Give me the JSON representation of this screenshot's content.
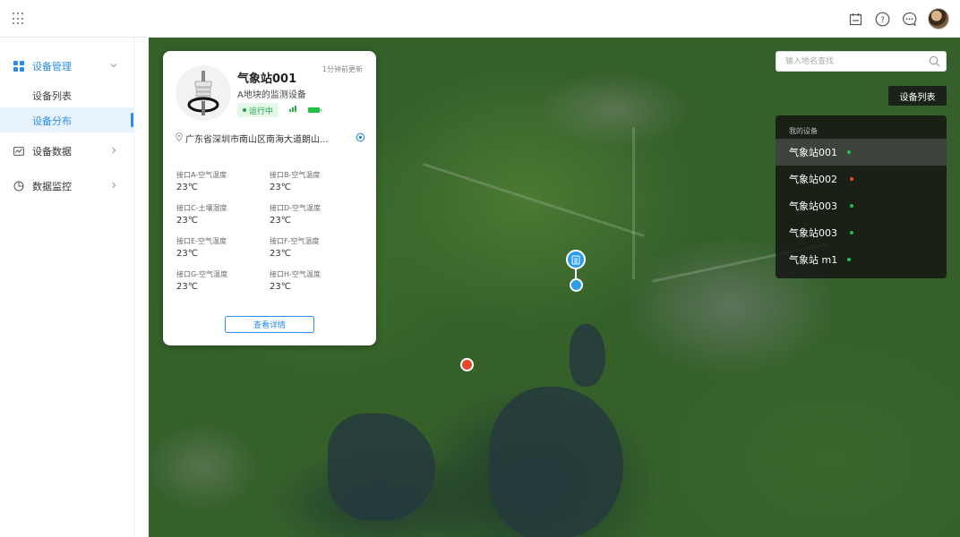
{
  "header": {
    "icons": [
      "apps-grid-icon",
      "calendar-icon",
      "help-icon",
      "message-icon",
      "user-avatar"
    ]
  },
  "sidebar": {
    "groups": [
      {
        "label": "设备管理",
        "icon": "dashboard-icon",
        "expanded": true,
        "items": [
          {
            "label": "设备列表",
            "active": false
          },
          {
            "label": "设备分布",
            "active": true
          }
        ]
      },
      {
        "label": "设备数据",
        "icon": "chart-icon",
        "expanded": false
      },
      {
        "label": "数据监控",
        "icon": "pie-icon",
        "expanded": false
      }
    ]
  },
  "map": {
    "search_placeholder": "输入地名查找",
    "device_list_button": "设备列表"
  },
  "device_card": {
    "name": "气象站001",
    "updated": "1分钟前更新",
    "subtitle": "A地块的监测设备",
    "status": "运行中",
    "address": "广东省深圳市南山区南海大道朗山...",
    "readings": [
      {
        "label": "接口A-空气温度",
        "value": "23℃"
      },
      {
        "label": "接口B-空气温度",
        "value": "23℃"
      },
      {
        "label": "接口C-土壤湿度",
        "value": "23℃"
      },
      {
        "label": "接口D-空气温度",
        "value": "23℃"
      },
      {
        "label": "接口E-空气温度",
        "value": "23℃"
      },
      {
        "label": "接口F-空气温度",
        "value": "23℃"
      },
      {
        "label": "接口G-空气温度",
        "value": "23℃"
      },
      {
        "label": "接口H-空气温度",
        "value": "23℃"
      }
    ],
    "detail_button": "查看详情"
  },
  "device_panel": {
    "title": "我的设备",
    "devices": [
      {
        "name": "气象站001",
        "status_color": "#22c047",
        "selected": true
      },
      {
        "name": "气象站002",
        "status_color": "#e8472b",
        "selected": false
      },
      {
        "name": "气象站003",
        "status_color": "#22c047",
        "selected": false
      },
      {
        "name": "气象站003",
        "status_color": "#22c047",
        "selected": false
      },
      {
        "name": "气象站 m1",
        "status_color": "#22c047",
        "selected": false
      }
    ]
  },
  "colors": {
    "accent": "#2b8be8",
    "online": "#22c047",
    "offline": "#e8472b"
  }
}
